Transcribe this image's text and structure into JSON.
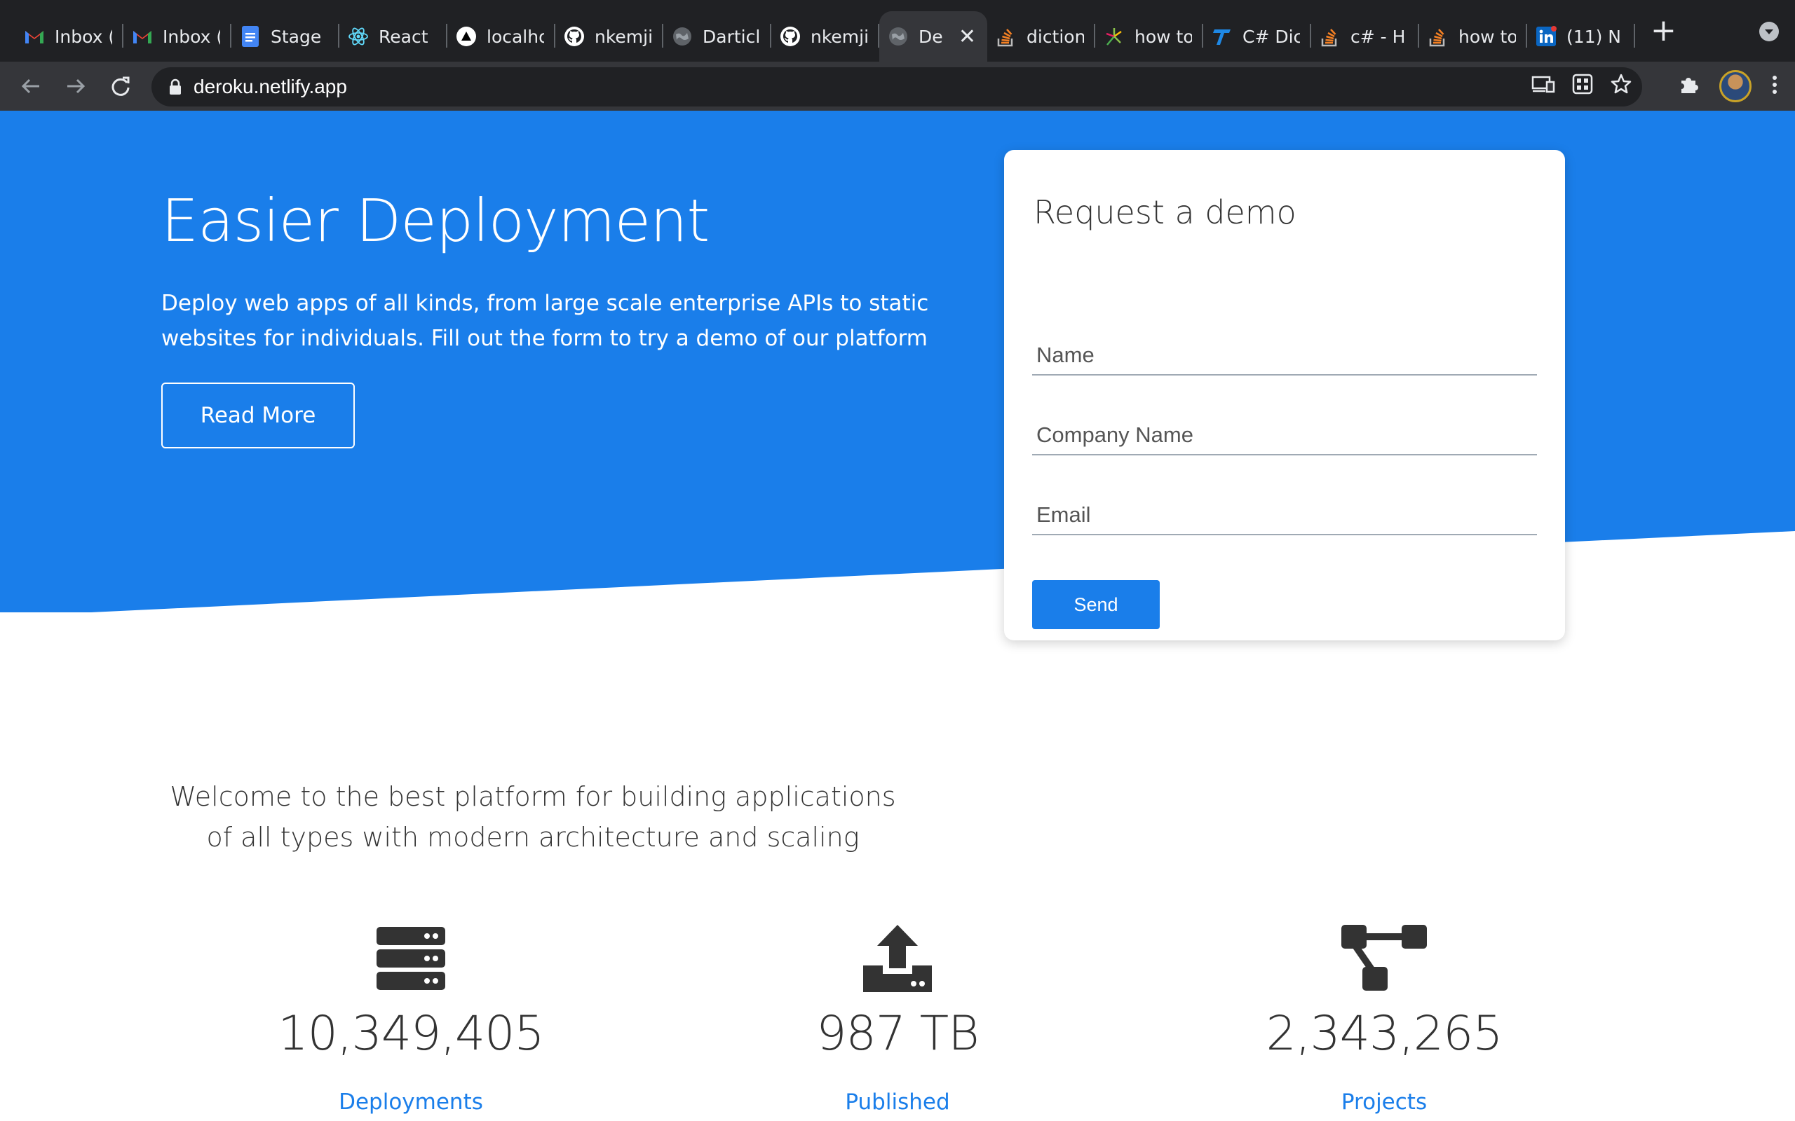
{
  "browser": {
    "tabs": [
      {
        "label": "Inbox (",
        "icon": "gmail-icon"
      },
      {
        "label": "Inbox (",
        "icon": "gmail-icon"
      },
      {
        "label": "Stage",
        "icon": "google-docs-icon"
      },
      {
        "label": "React",
        "icon": "react-icon"
      },
      {
        "label": "localho",
        "icon": "vercel-icon"
      },
      {
        "label": "nkemji",
        "icon": "github-icon"
      },
      {
        "label": "Darticl",
        "icon": "globe-icon"
      },
      {
        "label": "nkemji",
        "icon": "github-icon"
      },
      {
        "label": "Der",
        "icon": "globe-icon",
        "active": true
      },
      {
        "label": "diction",
        "icon": "stackoverflow-icon"
      },
      {
        "label": "how to",
        "icon": "sparkle-icon"
      },
      {
        "label": "C# Dic",
        "icon": "tutorialsteacher-icon"
      },
      {
        "label": "c# - H",
        "icon": "stackoverflow-icon"
      },
      {
        "label": "how to",
        "icon": "stackoverflow-icon"
      },
      {
        "label": "(11) N",
        "icon": "linkedin-icon"
      }
    ],
    "url": "deroku.netlify.app"
  },
  "hero": {
    "title": "Easier Deployment",
    "description": "Deploy web apps of all kinds, from large scale enterprise APIs to static websites for individuals. Fill out the form to try a demo of our platform",
    "read_more_label": "Read More",
    "background_color": "#1a7eea"
  },
  "demo_form": {
    "title": "Request a demo",
    "name_placeholder": "Name",
    "company_placeholder": "Company Name",
    "email_placeholder": "Email",
    "send_label": "Send"
  },
  "welcome_text": "Welcome to the best platform for building applications of all types with modern architecture and scaling",
  "stats": [
    {
      "icon": "server-stack-icon",
      "value": "10,349,405",
      "label": "Deployments"
    },
    {
      "icon": "upload-icon",
      "value": "987 TB",
      "label": "Published"
    },
    {
      "icon": "sitemap-icon",
      "value": "2,343,265",
      "label": "Projects"
    }
  ],
  "colors": {
    "accent": "#1a7eea",
    "chrome_dark": "#202124",
    "chrome_toolbar": "#35363a"
  }
}
